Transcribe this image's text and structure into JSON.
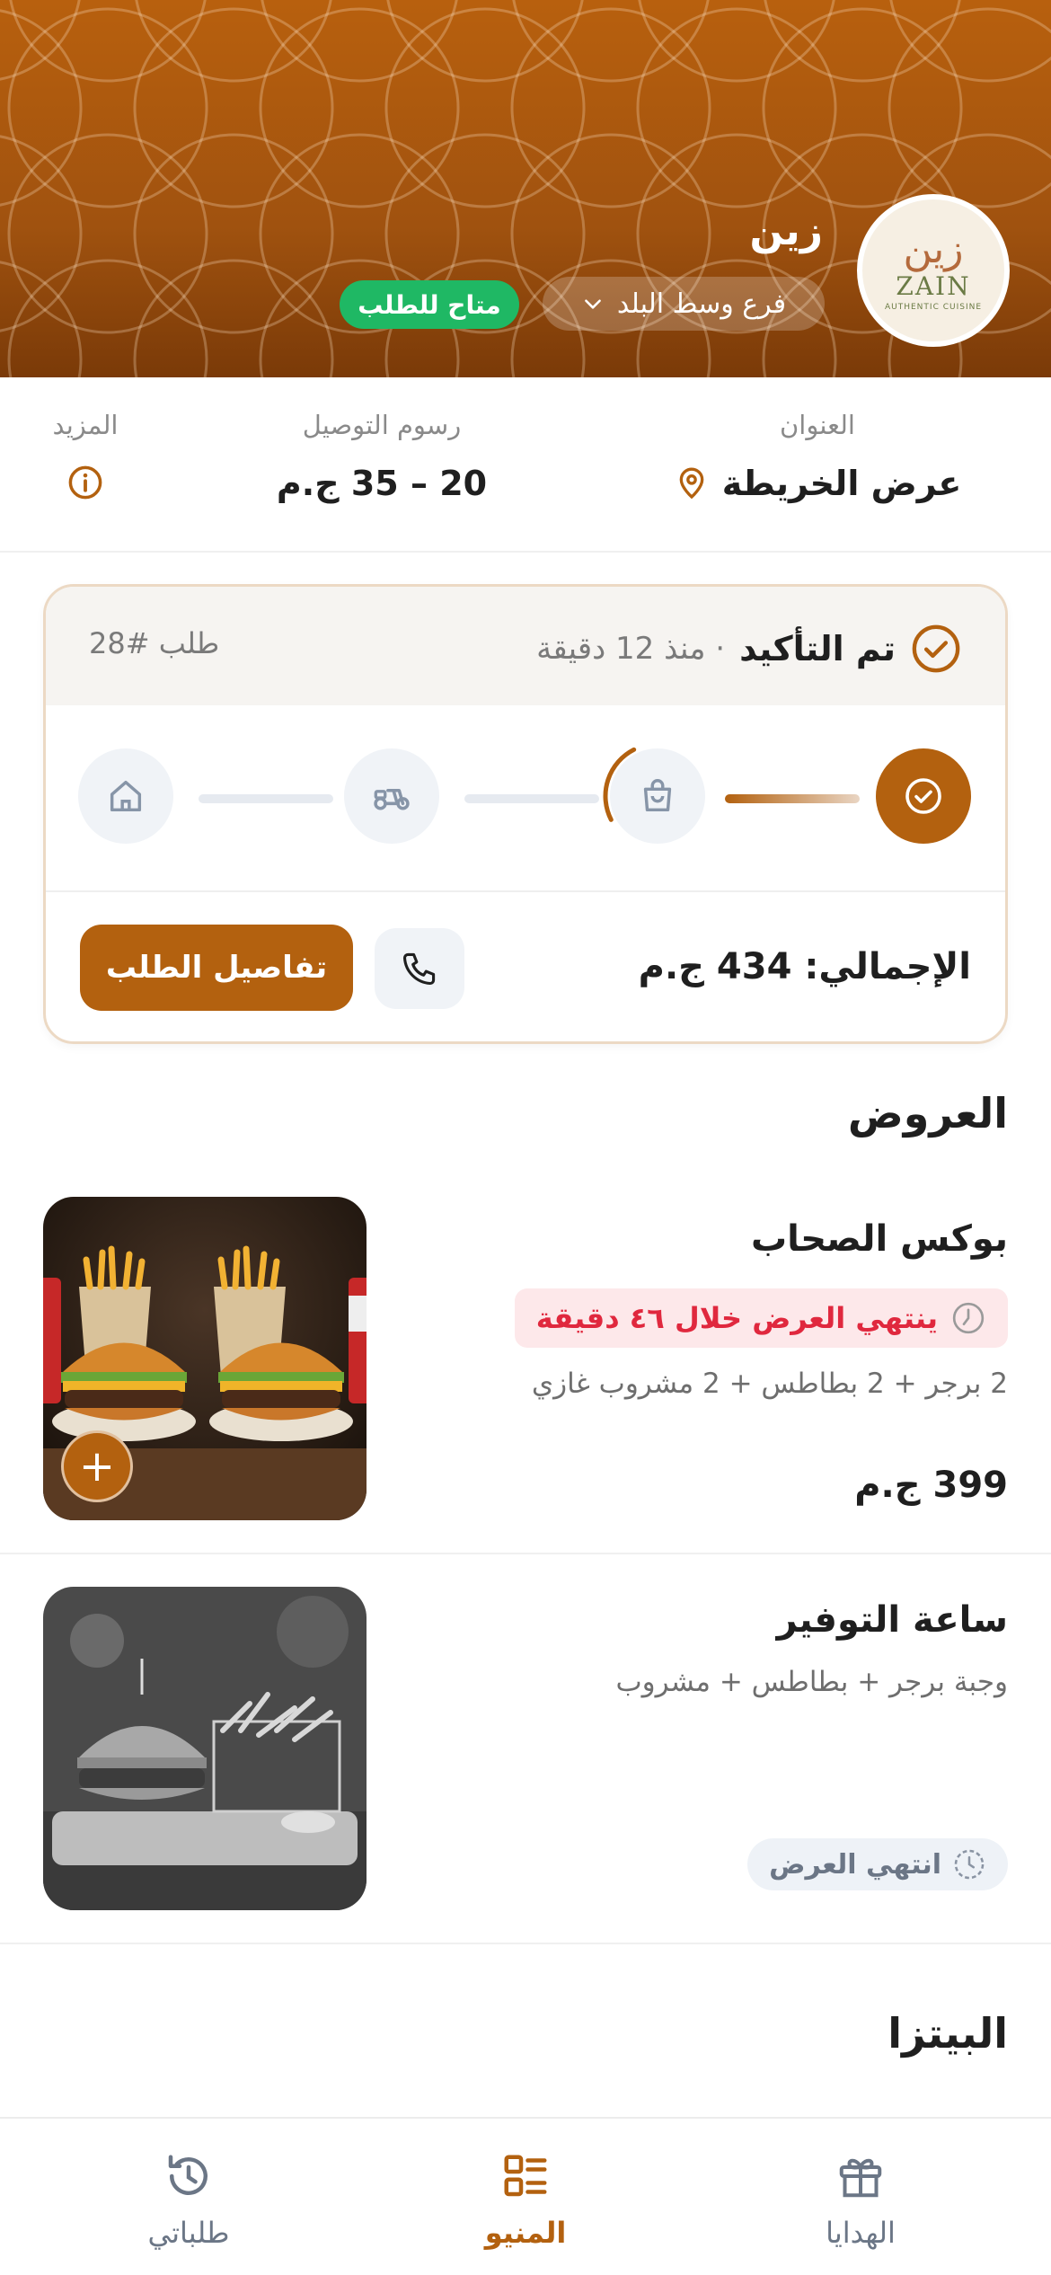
{
  "colors": {
    "brand": "#b3610f",
    "available": "#1fb864",
    "timer": "#e0283e"
  },
  "header": {
    "restaurant_name": "زين",
    "logo": {
      "ar": "زين",
      "en": "ZAIN",
      "tag": "AUTHENTIC CUISINE"
    },
    "branch": "فرع وسط البلد",
    "availability": "متاح للطلب"
  },
  "info": {
    "address_label": "العنوان",
    "address_value": "عرض الخريطة",
    "delivery_label": "رسوم التوصيل",
    "delivery_value": "20 – 35 ج.م",
    "more_label": "المزيد"
  },
  "order": {
    "status": "تم التأكيد",
    "time_ago": "· منذ 12 دقيقة",
    "number": "طلب #28",
    "total": "الإجمالي: 434 ج.م",
    "details_button": "تفاصيل الطلب",
    "progress": 0.25,
    "steps": [
      "check-icon",
      "bag-icon",
      "scooter-icon",
      "home-icon"
    ]
  },
  "offers_section": {
    "title": "العروض",
    "items": [
      {
        "title": "بوكس الصحاب",
        "timer": "ينتهي العرض خلال ٤٦ دقيقة",
        "desc": "2 برجر + 2 بطاطس + 2 مشروب غازي",
        "price": "399 ج.م",
        "add_label": "+"
      },
      {
        "title": "ساعة التوفير",
        "desc": "وجبة برجر + بطاطس + مشروب",
        "ended": "انتهي العرض"
      }
    ]
  },
  "pizza_section": {
    "title": "البيتزا"
  },
  "nav": {
    "gifts": "الهدايا",
    "menu": "المنيو",
    "orders": "طلباتي"
  }
}
